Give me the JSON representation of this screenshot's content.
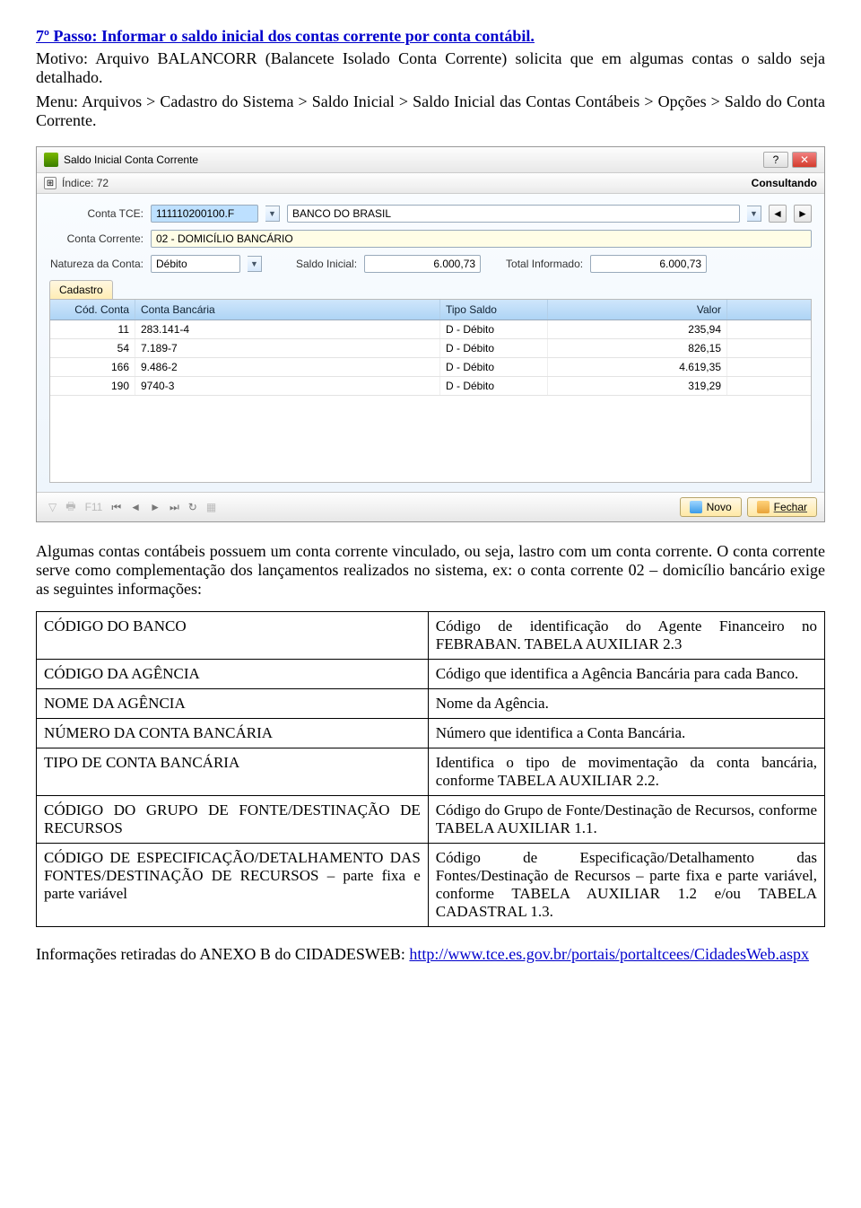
{
  "doc": {
    "heading": "7º Passo: Informar o saldo inicial dos contas corrente por conta contábil.",
    "para1": "Motivo: Arquivo BALANCORR (Balancete Isolado Conta Corrente) solicita que em algumas contas o saldo seja detalhado.",
    "para2": "Menu: Arquivos > Cadastro do Sistema > Saldo Inicial > Saldo Inicial das Contas Contábeis > Opções > Saldo do Conta Corrente."
  },
  "window": {
    "title": "Saldo Inicial Conta Corrente",
    "help_icon": "?",
    "close_icon": "✕",
    "indice_label": "Índice: 72",
    "status": "Consultando",
    "conta_tce_label": "Conta TCE:",
    "conta_tce_code": "111110200100.F",
    "conta_tce_desc": "BANCO DO BRASIL",
    "conta_corrente_label": "Conta Corrente:",
    "conta_corrente_value": "02 - DOMICÍLIO BANCÁRIO",
    "natureza_label": "Natureza da Conta:",
    "natureza_value": "Débito",
    "saldo_inicial_label": "Saldo Inicial:",
    "saldo_inicial_value": "6.000,73",
    "total_informado_label": "Total Informado:",
    "total_informado_value": "6.000,73",
    "tab_cadastro": "Cadastro",
    "cols": {
      "cod": "Cód. Conta",
      "conta": "Conta Bancária",
      "tipo": "Tipo Saldo",
      "valor": "Valor"
    },
    "rows": [
      {
        "cod": "11",
        "conta": "283.141-4",
        "tipo": "D - Débito",
        "valor": "235,94"
      },
      {
        "cod": "54",
        "conta": "7.189-7",
        "tipo": "D - Débito",
        "valor": "826,15"
      },
      {
        "cod": "166",
        "conta": "9.486-2",
        "tipo": "D - Débito",
        "valor": "4.619,35"
      },
      {
        "cod": "190",
        "conta": "9740-3",
        "tipo": "D - Débito",
        "valor": "319,29"
      }
    ],
    "f11_label": "F11",
    "btn_novo": "Novo",
    "btn_fechar": "Fechar"
  },
  "under": "Algumas contas contábeis possuem um conta corrente vinculado, ou seja, lastro com um conta corrente. O conta corrente serve como complementação dos lançamentos realizados no sistema, ex: o conta corrente 02 – domicílio bancário exige as seguintes informações:",
  "table": [
    {
      "l": "CÓDIGO DO BANCO",
      "r": "Código de identificação do Agente Financeiro no FEBRABAN. TABELA AUXILIAR 2.3"
    },
    {
      "l": "CÓDIGO DA AGÊNCIA",
      "r": "Código que identifica a Agência Bancária para cada Banco."
    },
    {
      "l": "NOME DA AGÊNCIA",
      "r": "Nome da Agência."
    },
    {
      "l": "NÚMERO DA CONTA BANCÁRIA",
      "r": "Número que identifica a Conta Bancária."
    },
    {
      "l": "TIPO DE CONTA BANCÁRIA",
      "r": "Identifica o tipo de movimentação da conta bancária, conforme TABELA AUXILIAR 2.2."
    },
    {
      "l": "CÓDIGO DO GRUPO DE FONTE/DESTINAÇÃO DE RECURSOS",
      "r": "Código do Grupo de Fonte/Destinação de Recursos, conforme TABELA AUXILIAR 1.1."
    },
    {
      "l": "CÓDIGO DE ESPECIFICAÇÃO/DETALHAMENTO DAS FONTES/DESTINAÇÃO DE RECURSOS – parte fixa e parte variável",
      "r": "Código de Especificação/Detalhamento das Fontes/Destinação de Recursos – parte fixa e parte variável, conforme TABELA AUXILIAR 1.2 e/ou TABELA CADASTRAL 1.3."
    }
  ],
  "foot": {
    "pre": "Informações retiradas do ANEXO B do CIDADESWEB: ",
    "link": "http://www.tce.es.gov.br/portais/portaltcees/CidadesWeb.aspx"
  }
}
